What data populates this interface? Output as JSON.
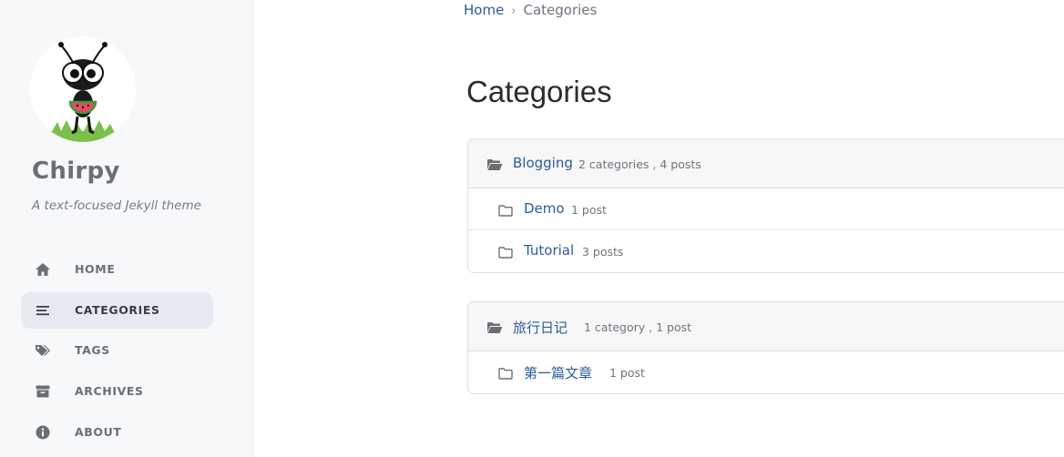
{
  "sidebar": {
    "site_title": "Chirpy",
    "site_subtitle": "A text-focused Jekyll theme",
    "nav": [
      {
        "label": "HOME",
        "icon": "home-icon"
      },
      {
        "label": "CATEGORIES",
        "icon": "list-icon",
        "active": true
      },
      {
        "label": "TAGS",
        "icon": "tags-icon"
      },
      {
        "label": "ARCHIVES",
        "icon": "archive-icon"
      },
      {
        "label": "ABOUT",
        "icon": "info-icon"
      }
    ]
  },
  "breadcrumb": {
    "home": "Home",
    "separator": "›",
    "current": "Categories"
  },
  "page_title": "Categories",
  "categories": [
    {
      "name": "Blogging",
      "meta": "2 categories , 4 posts",
      "subcategories": [
        {
          "name": "Demo",
          "meta": "1 post"
        },
        {
          "name": "Tutorial",
          "meta": "3 posts"
        }
      ]
    },
    {
      "name": "旅行日记",
      "meta": "1 category , 1 post",
      "subcategories": [
        {
          "name": "第一篇文章",
          "meta": "1 post"
        }
      ]
    }
  ],
  "colors": {
    "link": "#2a5b9a",
    "sidebar_bg": "#f6f8fa",
    "active_nav_bg": "#e6ebf1",
    "muted_text": "#6c757d"
  }
}
